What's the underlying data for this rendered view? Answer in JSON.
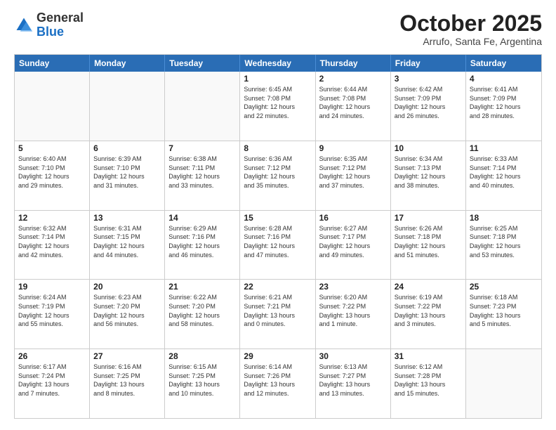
{
  "logo": {
    "general": "General",
    "blue": "Blue"
  },
  "title": "October 2025",
  "subtitle": "Arrufo, Santa Fe, Argentina",
  "headers": [
    "Sunday",
    "Monday",
    "Tuesday",
    "Wednesday",
    "Thursday",
    "Friday",
    "Saturday"
  ],
  "weeks": [
    [
      {
        "day": "",
        "info": ""
      },
      {
        "day": "",
        "info": ""
      },
      {
        "day": "",
        "info": ""
      },
      {
        "day": "1",
        "info": "Sunrise: 6:45 AM\nSunset: 7:08 PM\nDaylight: 12 hours\nand 22 minutes."
      },
      {
        "day": "2",
        "info": "Sunrise: 6:44 AM\nSunset: 7:08 PM\nDaylight: 12 hours\nand 24 minutes."
      },
      {
        "day": "3",
        "info": "Sunrise: 6:42 AM\nSunset: 7:09 PM\nDaylight: 12 hours\nand 26 minutes."
      },
      {
        "day": "4",
        "info": "Sunrise: 6:41 AM\nSunset: 7:09 PM\nDaylight: 12 hours\nand 28 minutes."
      }
    ],
    [
      {
        "day": "5",
        "info": "Sunrise: 6:40 AM\nSunset: 7:10 PM\nDaylight: 12 hours\nand 29 minutes."
      },
      {
        "day": "6",
        "info": "Sunrise: 6:39 AM\nSunset: 7:10 PM\nDaylight: 12 hours\nand 31 minutes."
      },
      {
        "day": "7",
        "info": "Sunrise: 6:38 AM\nSunset: 7:11 PM\nDaylight: 12 hours\nand 33 minutes."
      },
      {
        "day": "8",
        "info": "Sunrise: 6:36 AM\nSunset: 7:12 PM\nDaylight: 12 hours\nand 35 minutes."
      },
      {
        "day": "9",
        "info": "Sunrise: 6:35 AM\nSunset: 7:12 PM\nDaylight: 12 hours\nand 37 minutes."
      },
      {
        "day": "10",
        "info": "Sunrise: 6:34 AM\nSunset: 7:13 PM\nDaylight: 12 hours\nand 38 minutes."
      },
      {
        "day": "11",
        "info": "Sunrise: 6:33 AM\nSunset: 7:14 PM\nDaylight: 12 hours\nand 40 minutes."
      }
    ],
    [
      {
        "day": "12",
        "info": "Sunrise: 6:32 AM\nSunset: 7:14 PM\nDaylight: 12 hours\nand 42 minutes."
      },
      {
        "day": "13",
        "info": "Sunrise: 6:31 AM\nSunset: 7:15 PM\nDaylight: 12 hours\nand 44 minutes."
      },
      {
        "day": "14",
        "info": "Sunrise: 6:29 AM\nSunset: 7:16 PM\nDaylight: 12 hours\nand 46 minutes."
      },
      {
        "day": "15",
        "info": "Sunrise: 6:28 AM\nSunset: 7:16 PM\nDaylight: 12 hours\nand 47 minutes."
      },
      {
        "day": "16",
        "info": "Sunrise: 6:27 AM\nSunset: 7:17 PM\nDaylight: 12 hours\nand 49 minutes."
      },
      {
        "day": "17",
        "info": "Sunrise: 6:26 AM\nSunset: 7:18 PM\nDaylight: 12 hours\nand 51 minutes."
      },
      {
        "day": "18",
        "info": "Sunrise: 6:25 AM\nSunset: 7:18 PM\nDaylight: 12 hours\nand 53 minutes."
      }
    ],
    [
      {
        "day": "19",
        "info": "Sunrise: 6:24 AM\nSunset: 7:19 PM\nDaylight: 12 hours\nand 55 minutes."
      },
      {
        "day": "20",
        "info": "Sunrise: 6:23 AM\nSunset: 7:20 PM\nDaylight: 12 hours\nand 56 minutes."
      },
      {
        "day": "21",
        "info": "Sunrise: 6:22 AM\nSunset: 7:20 PM\nDaylight: 12 hours\nand 58 minutes."
      },
      {
        "day": "22",
        "info": "Sunrise: 6:21 AM\nSunset: 7:21 PM\nDaylight: 13 hours\nand 0 minutes."
      },
      {
        "day": "23",
        "info": "Sunrise: 6:20 AM\nSunset: 7:22 PM\nDaylight: 13 hours\nand 1 minute."
      },
      {
        "day": "24",
        "info": "Sunrise: 6:19 AM\nSunset: 7:22 PM\nDaylight: 13 hours\nand 3 minutes."
      },
      {
        "day": "25",
        "info": "Sunrise: 6:18 AM\nSunset: 7:23 PM\nDaylight: 13 hours\nand 5 minutes."
      }
    ],
    [
      {
        "day": "26",
        "info": "Sunrise: 6:17 AM\nSunset: 7:24 PM\nDaylight: 13 hours\nand 7 minutes."
      },
      {
        "day": "27",
        "info": "Sunrise: 6:16 AM\nSunset: 7:25 PM\nDaylight: 13 hours\nand 8 minutes."
      },
      {
        "day": "28",
        "info": "Sunrise: 6:15 AM\nSunset: 7:25 PM\nDaylight: 13 hours\nand 10 minutes."
      },
      {
        "day": "29",
        "info": "Sunrise: 6:14 AM\nSunset: 7:26 PM\nDaylight: 13 hours\nand 12 minutes."
      },
      {
        "day": "30",
        "info": "Sunrise: 6:13 AM\nSunset: 7:27 PM\nDaylight: 13 hours\nand 13 minutes."
      },
      {
        "day": "31",
        "info": "Sunrise: 6:12 AM\nSunset: 7:28 PM\nDaylight: 13 hours\nand 15 minutes."
      },
      {
        "day": "",
        "info": ""
      }
    ]
  ]
}
